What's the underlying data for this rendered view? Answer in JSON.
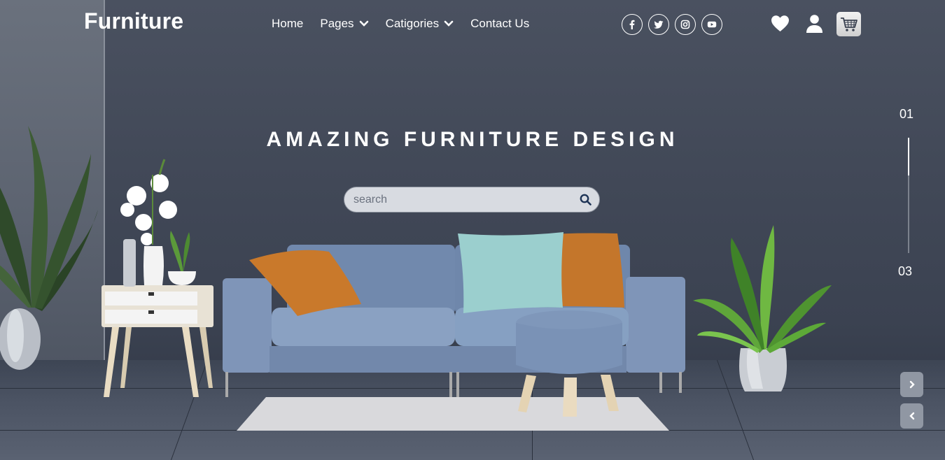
{
  "header": {
    "logo": "Furniture",
    "nav": [
      {
        "label": "Home",
        "dropdown": false
      },
      {
        "label": "Pages",
        "dropdown": true
      },
      {
        "label": "Catigories",
        "dropdown": true
      },
      {
        "label": "Contact Us",
        "dropdown": false
      }
    ],
    "socials": [
      "facebook-icon",
      "twitter-icon",
      "instagram-icon",
      "youtube-icon"
    ],
    "actions": [
      "heart-icon",
      "user-icon",
      "cart-icon"
    ]
  },
  "hero": {
    "headline": "AMAZING FURNITURE DESIGN",
    "search": {
      "placeholder": "search",
      "value": ""
    }
  },
  "slider": {
    "current": "01",
    "total": "03",
    "progress": 0.33
  },
  "colors": {
    "accent": "#ffffff",
    "sofa": "#7d93b5",
    "pillow_orange": "#c97a2c",
    "pillow_mint": "#9ed4d3",
    "wall": "#414857"
  }
}
